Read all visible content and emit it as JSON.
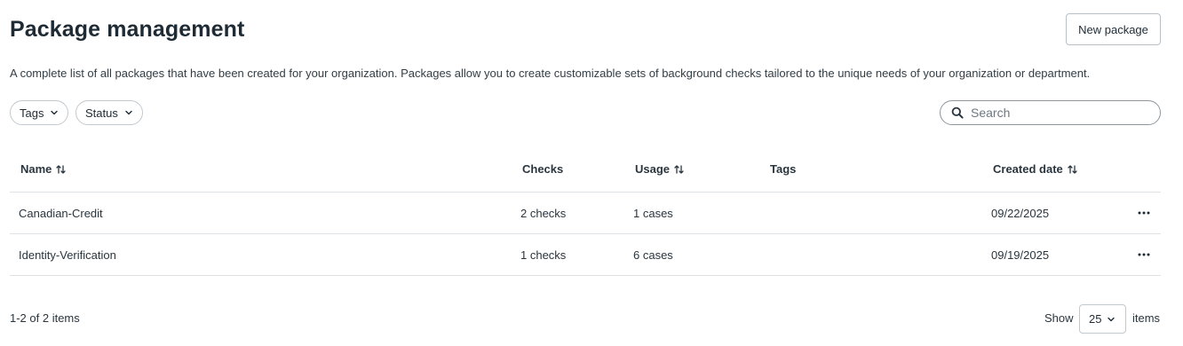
{
  "header": {
    "title": "Package management",
    "new_button_label": "New package",
    "description": "A complete list of all packages that have been created for your organization. Packages allow you to create customizable sets of background checks tailored to the unique needs of your organization or department."
  },
  "filters": {
    "tags_label": "Tags",
    "status_label": "Status"
  },
  "search": {
    "placeholder": "Search",
    "value": ""
  },
  "table": {
    "columns": {
      "name": "Name",
      "checks": "Checks",
      "usage": "Usage",
      "tags": "Tags",
      "created": "Created date"
    },
    "rows": [
      {
        "name": "Canadian-Credit",
        "checks": "2 checks",
        "usage": "1 cases",
        "tags": "",
        "created": "09/22/2025"
      },
      {
        "name": "Identity-Verification",
        "checks": "1 checks",
        "usage": "6 cases",
        "tags": "",
        "created": "09/19/2025"
      }
    ]
  },
  "footer": {
    "count": "1-2 of 2 items",
    "show_label": "Show",
    "page_size": "25",
    "items_label": "items"
  },
  "icons": {
    "filter_chevron": "chevron-down-icon",
    "sort": "sort-icon",
    "search": "search-icon",
    "row_actions": "more-horizontal-icon"
  },
  "colors": {
    "text": "#1f2a33",
    "border": "#c3c9ce",
    "divider": "#dfe3e6"
  }
}
